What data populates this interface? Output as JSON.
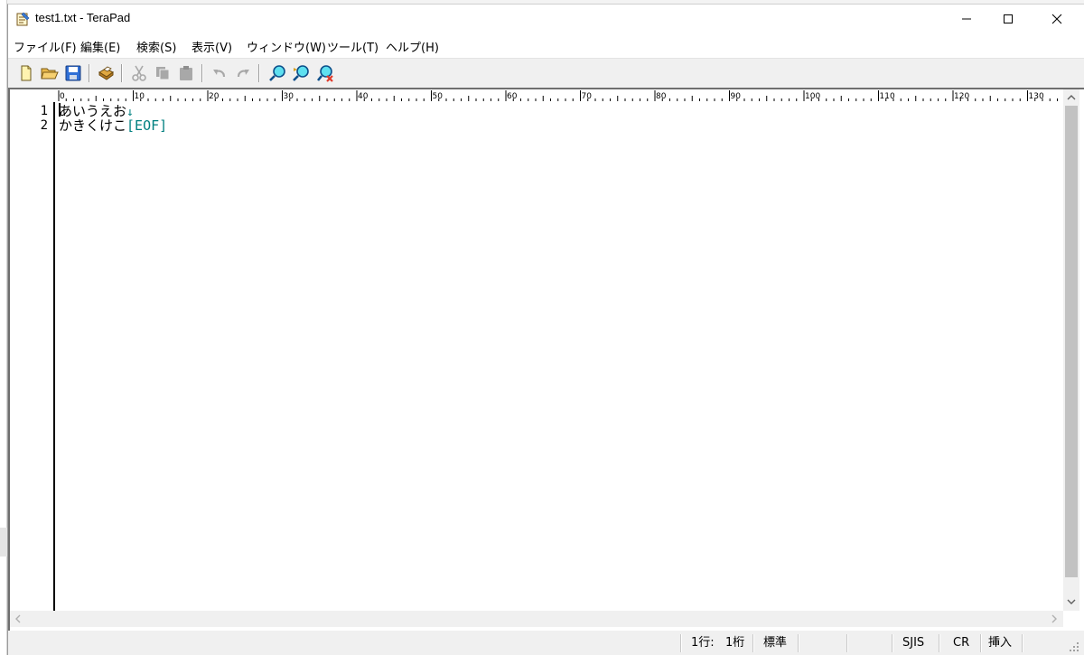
{
  "window": {
    "title": "test1.txt - TeraPad"
  },
  "menu": {
    "items": [
      "ファイル(F)",
      "編集(E)",
      "検索(S)",
      "表示(V)",
      "ウィンドウ(W)",
      "ツール(T)",
      "ヘルプ(H)"
    ]
  },
  "toolbar": {
    "buttons": [
      "new-file",
      "open-file",
      "save-file",
      "print",
      "cut",
      "copy",
      "paste",
      "undo",
      "redo",
      "find",
      "find-next",
      "replace"
    ]
  },
  "ruler": {
    "labels": [
      "0",
      "10",
      "20",
      "30",
      "40",
      "50",
      "60",
      "70",
      "80",
      "90",
      "100",
      "110",
      "120",
      "130"
    ]
  },
  "editor": {
    "lines": [
      {
        "number": "1",
        "text": "あいうえお",
        "end_mark": "↓"
      },
      {
        "number": "2",
        "text": "かきくけこ",
        "end_mark": "[EOF]"
      }
    ]
  },
  "status": {
    "line": "1行:",
    "column": "1桁",
    "mode": "標準",
    "encoding": "SJIS",
    "newline": "CR",
    "insert": "挿入"
  },
  "colors": {
    "eof_mark": "#008080",
    "gutter_border": "#000000"
  }
}
